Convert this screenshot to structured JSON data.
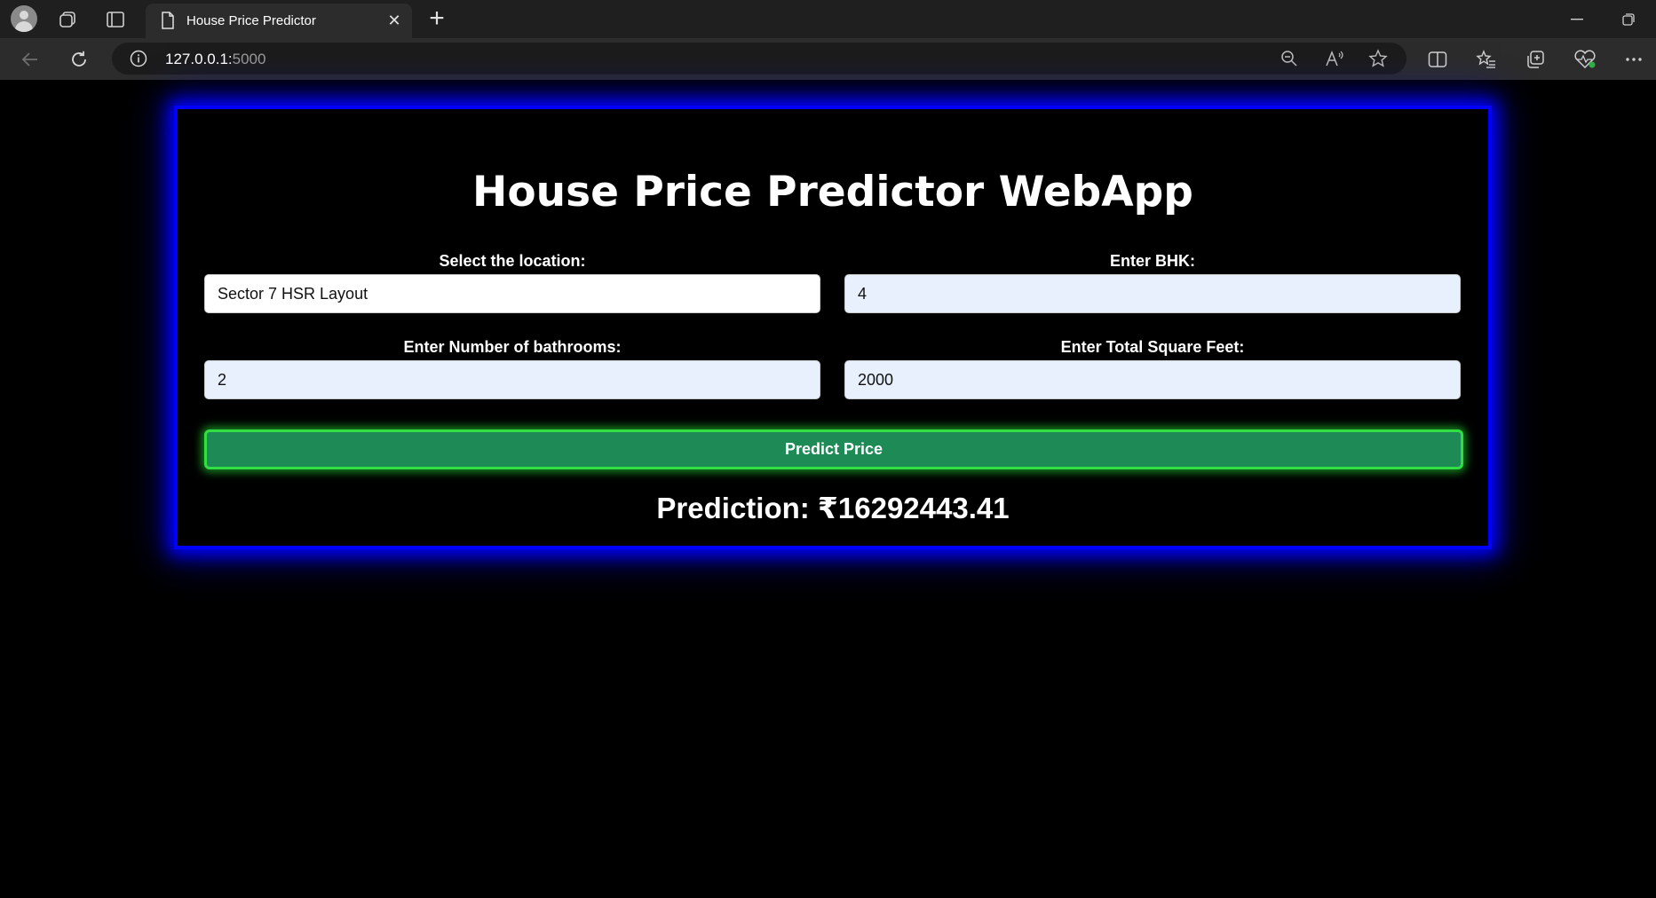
{
  "browser": {
    "tab_title": "House Price Predictor",
    "tab_close": "✕",
    "new_tab": "+",
    "url_host": "127.0.0.1:",
    "url_port": "5000"
  },
  "page": {
    "title": "House Price Predictor WebApp",
    "location": {
      "label": "Select the location:",
      "value": "Sector 7 HSR Layout"
    },
    "bhk": {
      "label": "Enter BHK:",
      "value": "4"
    },
    "bathrooms": {
      "label": "Enter Number of bathrooms:",
      "value": "2"
    },
    "sqft": {
      "label": "Enter Total Square Feet:",
      "value": "2000"
    },
    "predict_button": "Predict Price",
    "prediction_text": "Prediction: ₹16292443.41"
  },
  "colors": {
    "card_border": "#0000ff",
    "button_bg": "#1e8b57",
    "button_border": "#33dd44"
  }
}
